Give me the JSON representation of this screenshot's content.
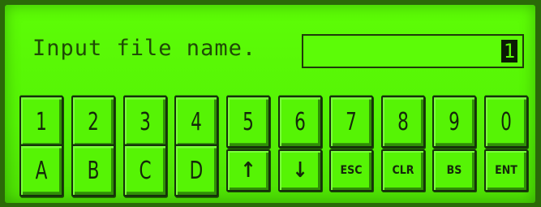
{
  "prompt": "Input file name.",
  "input": {
    "value": "1"
  },
  "keys_row1": [
    "1",
    "2",
    "3",
    "4",
    "5",
    "6",
    "7",
    "8",
    "9",
    "0"
  ],
  "keys_row2": [
    "A",
    "B",
    "C",
    "D",
    "↑",
    "↓",
    "ESC",
    "CLR",
    "BS",
    "ENT"
  ]
}
